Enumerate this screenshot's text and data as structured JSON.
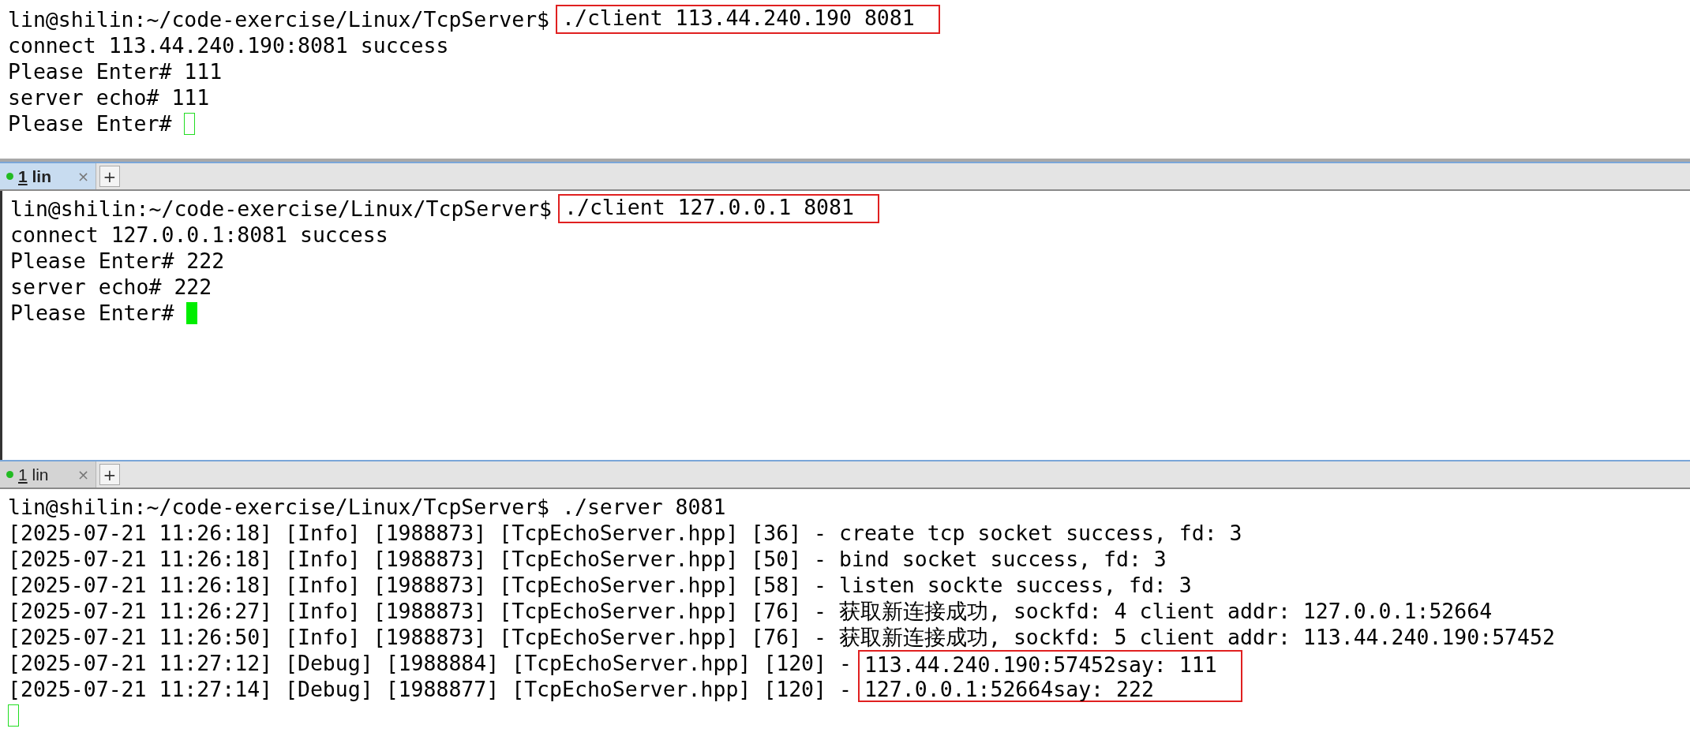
{
  "panes": [
    {
      "cursor": {
        "focused": false,
        "own_line": false
      },
      "lines": [
        {
          "text": "lin@shilin:~/code-exercise/Linux/TcpServer$ ",
          "boxed": "./client 113.44.240.190 8081"
        },
        {
          "text": "connect 113.44.240.190:8081 success"
        },
        {
          "text": "Please Enter# 111"
        },
        {
          "text": "server echo# 111"
        },
        {
          "text": "Please Enter# "
        }
      ]
    },
    {
      "tab": {
        "number": "1",
        "label": "lin",
        "close": "×",
        "selected": true
      },
      "new_tab": "+",
      "cursor": {
        "focused": true,
        "own_line": false
      },
      "lines": [
        {
          "text": "lin@shilin:~/code-exercise/Linux/TcpServer$ ",
          "boxed": "./client 127.0.0.1 8081"
        },
        {
          "text": "connect 127.0.0.1:8081 success"
        },
        {
          "text": "Please Enter# 222"
        },
        {
          "text": "server echo# 222"
        },
        {
          "text": "Please Enter# "
        }
      ]
    },
    {
      "tab": {
        "number": "1",
        "label": "lin",
        "close": "×",
        "selected": false
      },
      "new_tab": "+",
      "cursor": {
        "focused": false,
        "own_line": true
      },
      "lines": [
        {
          "text": "lin@shilin:~/code-exercise/Linux/TcpServer$ ./server 8081"
        },
        {
          "text": "[2025-07-21 11:26:18] [Info] [1988873] [TcpEchoServer.hpp] [36] - create tcp socket success, fd: 3"
        },
        {
          "text": "[2025-07-21 11:26:18] [Info] [1988873] [TcpEchoServer.hpp] [50] - bind socket success, fd: 3"
        },
        {
          "text": "[2025-07-21 11:26:18] [Info] [1988873] [TcpEchoServer.hpp] [58] - listen sockte success, fd: 3"
        },
        {
          "text": "[2025-07-21 11:26:27] [Info] [1988873] [TcpEchoServer.hpp] [76] - 获取新连接成功, sockfd: 4 client addr: 127.0.0.1:52664"
        },
        {
          "text": "[2025-07-21 11:26:50] [Info] [1988873] [TcpEchoServer.hpp] [76] - 获取新连接成功, sockfd: 5 client addr: 113.44.240.190:57452"
        },
        {
          "text": "[2025-07-21 11:27:12] [Debug] [1988884] [TcpEchoServer.hpp] [120] - ",
          "boxed": "113.44.240.190:57452say: 111"
        },
        {
          "text": "[2025-07-21 11:27:14] [Debug] [1988877] [TcpEchoServer.hpp] [120] - ",
          "boxed": "127.0.0.1:52664say: 222"
        }
      ]
    }
  ]
}
